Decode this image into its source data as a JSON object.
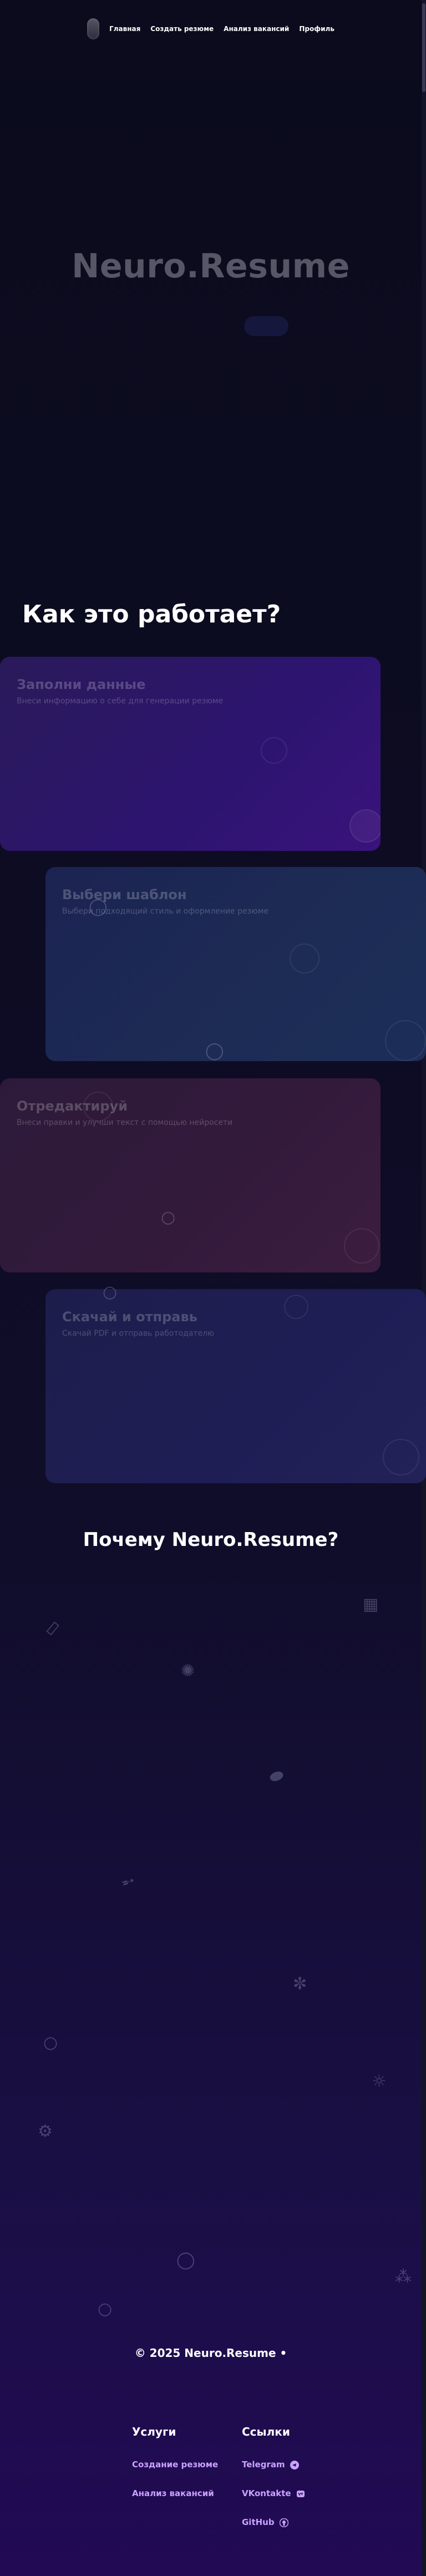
{
  "nav": {
    "items": [
      {
        "label": "Главная"
      },
      {
        "label": "Создать резюме"
      },
      {
        "label": "Анализ вакансий"
      },
      {
        "label": "Профиль"
      }
    ]
  },
  "hero": {
    "title": "Neuro.Resume"
  },
  "how": {
    "title": "Как это работает?",
    "steps": [
      {
        "title": "Заполни данные",
        "description": "Внеси информацию о себе для генерации резюме"
      },
      {
        "title": "Выбери шаблон",
        "description": "Выбери подходящий стиль и оформление резюме"
      },
      {
        "title": "Отредактируй",
        "description": "Внеси правки и улучши текст с помощью нейросети"
      },
      {
        "title": "Скачай и отправь",
        "description": "Скачай PDF и отправь работодателю"
      }
    ]
  },
  "why": {
    "title": "Почему Neuro.Resume?"
  },
  "footer": {
    "copyright": "© 2025 Neuro.Resume •",
    "services": {
      "title": "Услуги",
      "items": [
        {
          "label": "Создание резюме"
        },
        {
          "label": "Анализ вакансий"
        }
      ]
    },
    "links": {
      "title": "Ссылки",
      "items": [
        {
          "label": "Telegram",
          "icon": "telegram-icon"
        },
        {
          "label": "VKontakte",
          "icon": "vk-icon"
        },
        {
          "label": "GitHub",
          "icon": "github-icon"
        }
      ]
    }
  },
  "colors": {
    "accent": "#c9a2ff",
    "background": "#0b0b1d"
  }
}
